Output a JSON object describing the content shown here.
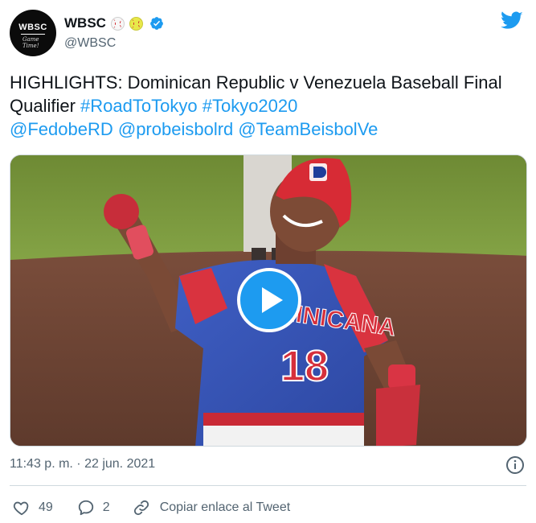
{
  "user": {
    "avatar_text": "WBSC",
    "avatar_script": "Game Time!",
    "display_name": "WBSC",
    "handle": "@WBSC"
  },
  "tweet": {
    "text_plain_1": "HIGHLIGHTS: Dominican Republic v Venezuela Baseball Final Qualifier ",
    "hashtag_1": "#RoadToTokyo",
    "hashtag_2": "#Tokyo2020",
    "mention_1": "@FedobeRD",
    "mention_2": "@probeisbolrd",
    "mention_3": "@TeamBeisbolVe",
    "timestamp": "11:43 p. m. · 22 jun. 2021"
  },
  "media": {
    "jersey_number": "18",
    "jersey_text": "DOMINICANA"
  },
  "actions": {
    "likes": "49",
    "replies": "2",
    "copy_link_label": "Copiar enlace al Tweet"
  },
  "colors": {
    "accent": "#1d9bf0",
    "text": "#0f1419",
    "muted": "#536471"
  },
  "icons": {
    "verified": "verified-badge-icon",
    "twitter": "twitter-bird-icon",
    "info": "info-icon",
    "like": "heart-icon",
    "reply": "speech-bubble-icon",
    "copy": "link-icon",
    "play": "play-icon"
  }
}
